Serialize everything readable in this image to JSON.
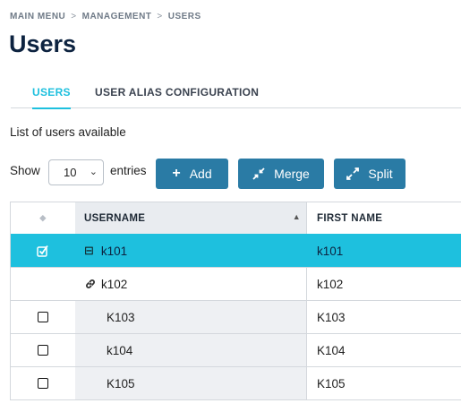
{
  "breadcrumb": {
    "items": [
      "MAIN MENU",
      "MANAGEMENT",
      "USERS"
    ],
    "separator": ">"
  },
  "page": {
    "title": "Users"
  },
  "tabs": [
    {
      "label": "USERS",
      "active": true
    },
    {
      "label": "USER ALIAS CONFIGURATION",
      "active": false
    }
  ],
  "subtitle": "List of users available",
  "pagination": {
    "show_label": "Show",
    "entries_value": "10",
    "entries_label": "entries"
  },
  "toolbar": {
    "add_label": "Add",
    "merge_label": "Merge",
    "split_label": "Split"
  },
  "table": {
    "headers": {
      "username": "USERNAME",
      "first_name": "FIRST NAME"
    },
    "rows": [
      {
        "username": "k101",
        "first_name": "k101",
        "selected": true
      },
      {
        "username": "k102",
        "first_name": "k102",
        "selected": false
      },
      {
        "username": "K103",
        "first_name": "K103",
        "selected": false
      },
      {
        "username": "k104",
        "first_name": "K104",
        "selected": false
      },
      {
        "username": "K105",
        "first_name": "K105",
        "selected": false
      }
    ]
  },
  "colors": {
    "accent": "#1ec0de",
    "button": "#2a7ba5",
    "title": "#0d2340"
  },
  "icons": {
    "add": "plus-icon",
    "merge": "compress-arrows-icon",
    "split": "expand-arrows-icon",
    "row_1": "collapse-icon",
    "row_2": "link-icon",
    "sort": "sort-asc-icon"
  }
}
